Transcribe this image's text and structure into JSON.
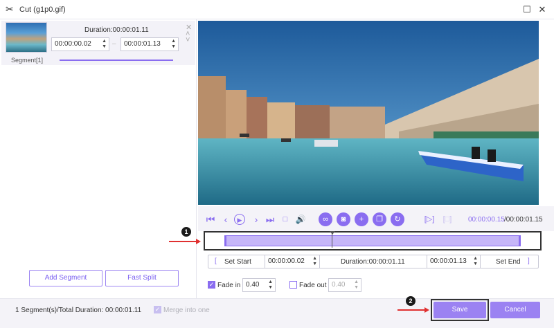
{
  "window": {
    "title": "Cut (g1p0.gif)",
    "app_icon": "scissors-icon",
    "maximize_icon": "maximize-icon",
    "close_icon": "close-icon"
  },
  "segment": {
    "duration_label": "Duration:00:00:01.11",
    "start_time": "00:00:00.02",
    "end_time": "00:00:01.13",
    "label": "Segment[1]"
  },
  "left_buttons": {
    "add_segment": "Add Segment",
    "fast_split": "Fast Split"
  },
  "playback": {
    "current_time": "00:00:00.15",
    "total_time": "/00:00:01.15"
  },
  "set_row": {
    "set_start": "Set Start",
    "start_value": "00:00:00.02",
    "duration": "Duration:00:00:01.11",
    "end_value": "00:00:01.13",
    "set_end": "Set End"
  },
  "fade": {
    "fade_in_label": "Fade in",
    "fade_in_value": "0.40",
    "fade_in_checked": true,
    "fade_out_label": "Fade out",
    "fade_out_value": "0.40",
    "fade_out_checked": false
  },
  "footer": {
    "summary": "1 Segment(s)/Total Duration: 00:00:01.11",
    "merge_label": "Merge into one",
    "save": "Save",
    "cancel": "Cancel"
  },
  "annotations": {
    "marker_1": "1",
    "marker_2": "2"
  },
  "colors": {
    "accent": "#8a6df0",
    "button_fill": "#9b82f2",
    "annotation_red": "#e03030"
  }
}
